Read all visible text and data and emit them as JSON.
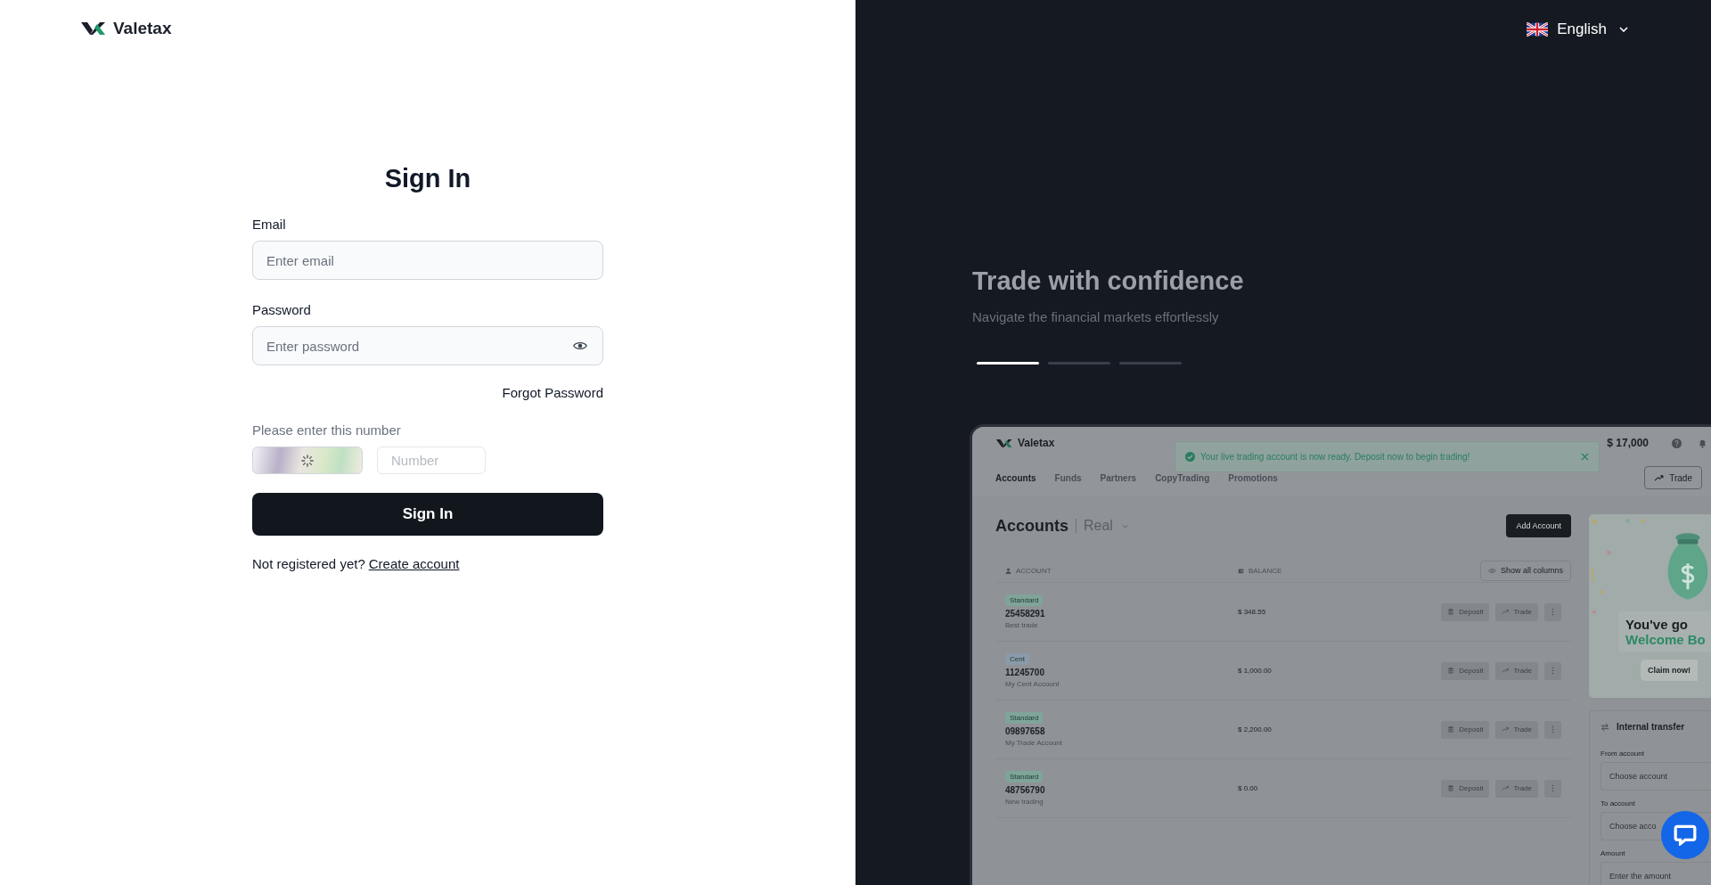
{
  "header": {
    "logo_text": "Valetax"
  },
  "language": {
    "label": "English"
  },
  "form": {
    "title": "Sign In",
    "email": {
      "label": "Email",
      "placeholder": "Enter email"
    },
    "password": {
      "label": "Password",
      "placeholder": "Enter password"
    },
    "forgot": "Forgot Password",
    "captcha": {
      "label": "Please enter this number",
      "placeholder": "Number"
    },
    "submit": "Sign In",
    "register": {
      "text": "Not registered yet?",
      "link": "Create account"
    }
  },
  "hero": {
    "title": "Trade with confidence",
    "subtitle": "Navigate the financial markets effortlessly",
    "slides": [
      {
        "selected": true
      },
      {
        "selected": false
      },
      {
        "selected": false
      }
    ]
  },
  "preview": {
    "logo_text": "Valetax",
    "total_funds": "$ 17,000",
    "toast": "Your live trading account is now ready. Deposit now to begin trading!",
    "nav": [
      {
        "label": "Accounts",
        "selected": true
      },
      {
        "label": "Funds",
        "selected": false
      },
      {
        "label": "Partners",
        "selected": false
      },
      {
        "label": "CopyTrading",
        "selected": false
      },
      {
        "label": "Promotions",
        "selected": false
      }
    ],
    "trade_button": "Trade",
    "heading": "Accounts",
    "account_type": "Real",
    "add_account": "Add Account",
    "columns": [
      "ACCOUNT",
      "BALANCE"
    ],
    "show_columns": "Show all columns",
    "rows": [
      {
        "type": "Standard",
        "color": "#7fa49a",
        "number": "25458291",
        "name": "Best trade",
        "balance": "$ 348.55",
        "deposit": "Deposit",
        "trade": "Trade"
      },
      {
        "type": "Cent",
        "color": "#8a9aaa",
        "number": "11245700",
        "name": "My Cent Account",
        "balance": "$ 1,000.00",
        "deposit": "Deposit",
        "trade": "Trade"
      },
      {
        "type": "Standard",
        "color": "#7fa49a",
        "number": "09897658",
        "name": "My Trade Account",
        "balance": "$ 2,200.00",
        "deposit": "Deposit",
        "trade": "Trade"
      },
      {
        "type": "Standard",
        "color": "#7fa49a",
        "number": "48756790",
        "name": "New trading",
        "balance": "$ 0.00",
        "deposit": "Deposit",
        "trade": "Trade"
      }
    ],
    "promo": {
      "title": "You've go",
      "highlight": "Welcome Bo",
      "button": "Claim now!"
    },
    "transfer": {
      "title": "Internal transfer",
      "fields": [
        {
          "label": "From account",
          "placeholder": "Choose account"
        },
        {
          "label": "To account",
          "placeholder": "Choose acco"
        },
        {
          "label": "Amount",
          "placeholder": "Enter the amount"
        }
      ]
    }
  }
}
